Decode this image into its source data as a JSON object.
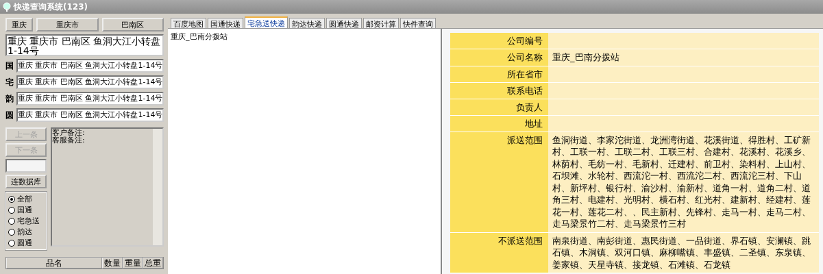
{
  "window": {
    "title": "快递查询系统(123)"
  },
  "region_buttons": [
    "重庆",
    "重庆市",
    "巴南区"
  ],
  "full_address": "重庆 重庆市 巴南区 鱼洞大江小转盘1-14号",
  "carrier_addresses": [
    {
      "label": "国",
      "value": "重庆 重庆市 巴南区 鱼洞大江小转盘1-14号"
    },
    {
      "label": "宅",
      "value": "重庆 重庆市 巴南区 鱼洞大江小转盘1-14号"
    },
    {
      "label": "韵",
      "value": "重庆 重庆市 巴南区 鱼洞大江小转盘1-14号"
    },
    {
      "label": "圆",
      "value": "重庆 重庆市 巴南区 鱼洞大江小转盘1-14号"
    }
  ],
  "nav_buttons": [
    {
      "label": "上一条",
      "disabled": true
    },
    {
      "label": "下一条",
      "disabled": true
    }
  ],
  "connect_button": "连数据库",
  "filter_options": [
    {
      "label": "全部",
      "selected": true
    },
    {
      "label": "国通",
      "selected": false
    },
    {
      "label": "宅急送",
      "selected": false
    },
    {
      "label": "韵达",
      "selected": false
    },
    {
      "label": "圆通",
      "selected": false
    }
  ],
  "notes": [
    "客户备注:",
    "客服备注:"
  ],
  "items_table": {
    "columns": [
      "品名",
      "数量",
      "重量",
      "总重"
    ]
  },
  "tabs": [
    {
      "label": "百度地图",
      "selected": false
    },
    {
      "label": "国通快递",
      "selected": false
    },
    {
      "label": "宅急送快递",
      "selected": true
    },
    {
      "label": "韵达快递",
      "selected": false
    },
    {
      "label": "圆通快递",
      "selected": false
    },
    {
      "label": "邮资计算",
      "selected": false
    },
    {
      "label": "快件查询",
      "selected": false
    }
  ],
  "result_list": [
    "重庆_巴南分拨站"
  ],
  "company_info": [
    {
      "label": "公司编号"
    },
    {
      "label": "公司名称",
      "value": "重庆_巴南分拨站"
    },
    {
      "label": "所在省市"
    },
    {
      "label": "联系电话"
    },
    {
      "label": "负责人"
    },
    {
      "label": "地址"
    },
    {
      "label": "派送范围",
      "value": "鱼洞街道、李家沱街道、龙洲湾街道、花溪街道、得胜村、工矿新村、工联一村、工联二村、工联三村、合建村、花溪村、花溪乡、林荫村、毛纺一村、毛新村、迁建村、前卫村、染料村、上山村、石坝滩、水轮村、西流沱一村、西流沱二村、西流沱三村、下山村、新坪村、银行村、渝沙村、渝新村、道角一村、道角二村、道角三村、电建村、光明村、横石村、红光村、建新村、经建村、莲花一村、莲花二村、、民主新村、先锋村、走马一村、走马二村、走马梁景竹二村、走马梁景竹三村"
    },
    {
      "label": "不派送范围",
      "value": "南泉街道、南彭街道、惠民街道、一品街道、界石镇、安澜镇、跳石镇、木洞镇、双河口镇、麻柳嘴镇、丰盛镇、二圣镇、东泉镇、姜家镇、天星寺镇、接龙镇、石滩镇、石龙镇"
    }
  ]
}
